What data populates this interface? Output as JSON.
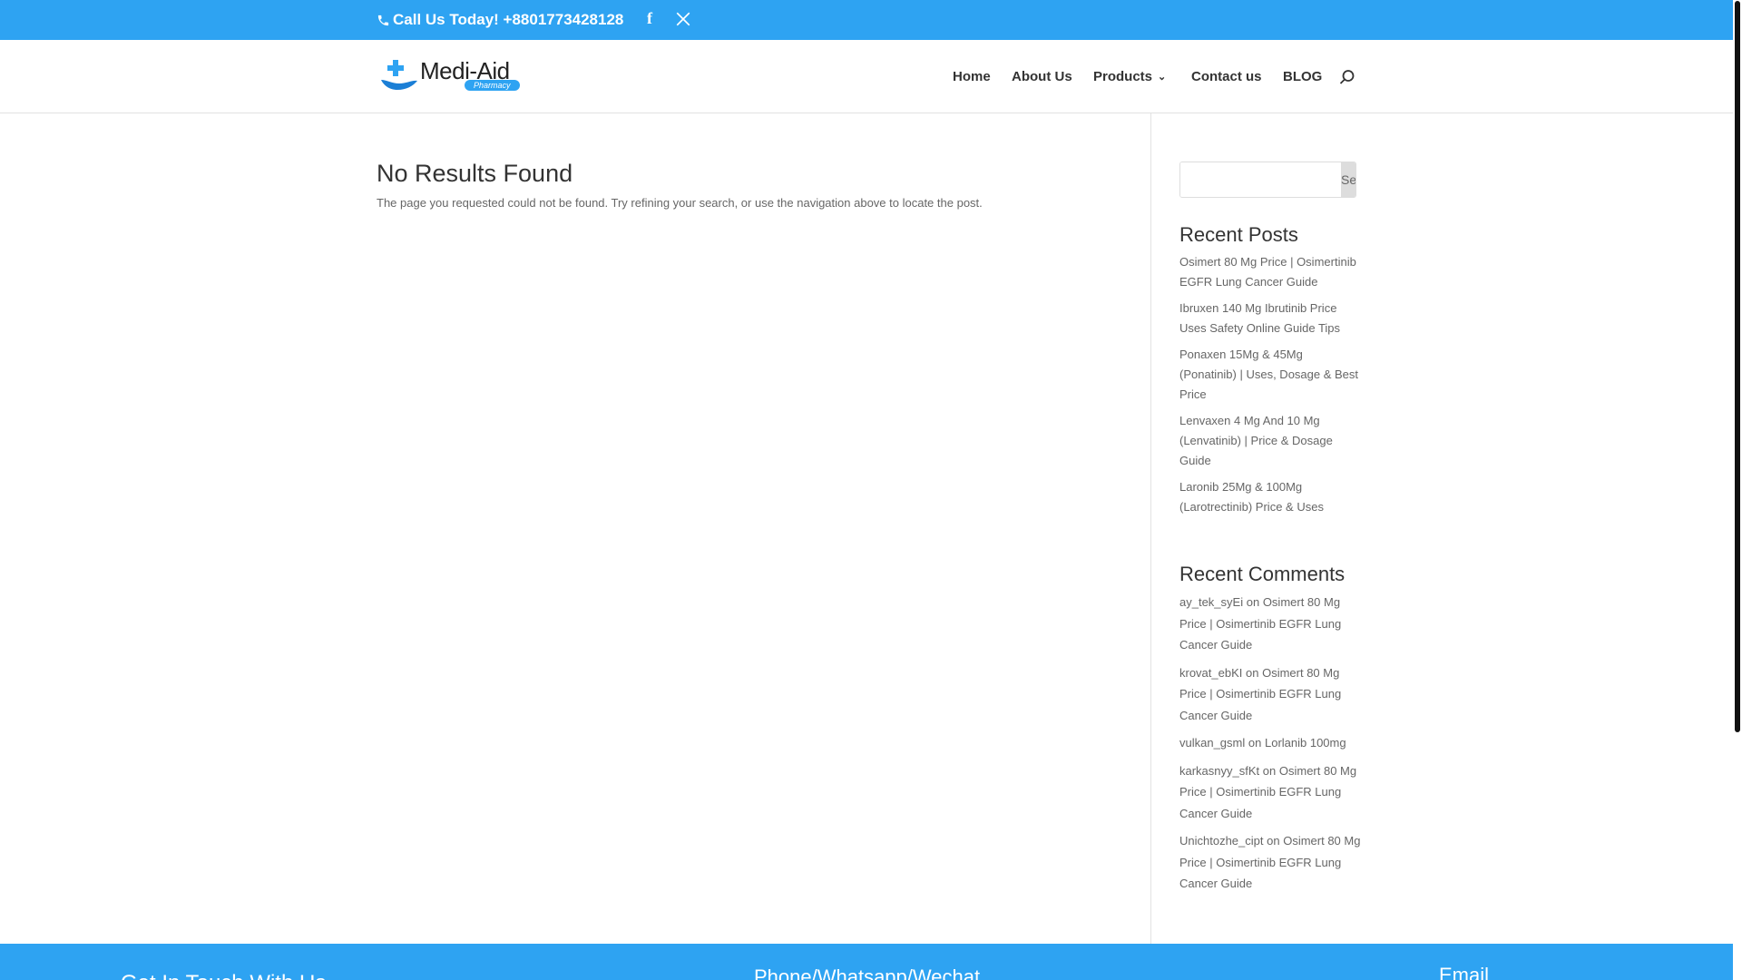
{
  "topbar": {
    "call": "Call Us Today! +8801773428128",
    "facebook_icon": "facebook-icon",
    "x_icon": "x-twitter-icon"
  },
  "header": {
    "logo_text": "Medi-Aid",
    "logo_sub": "Pharmacy",
    "nav": [
      "Home",
      "About Us",
      "Products",
      "Contact us",
      "BLOG"
    ]
  },
  "main": {
    "title": "No Results Found",
    "message": "The page you requested could not be found. Try refining your search, or use the navigation above to locate the post."
  },
  "sidebar": {
    "search_button": "Search",
    "search_value": "",
    "recent_posts_title": "Recent Posts",
    "recent_posts": [
      "Osimert 80 Mg Price | Osimertinib EGFR Lung Cancer Guide",
      "Ibruxen 140 Mg Ibrutinib Price Uses Safety Online Guide Tips",
      "Ponaxen 15Mg & 45Mg (Ponatinib) | Uses, Dosage & Best Price",
      "Lenvaxen 4 Mg And 10 Mg (Lenvatinib) | Price & Dosage Guide",
      "Laronib 25Mg & 100Mg (Larotrectinib) Price & Uses"
    ],
    "recent_comments_title": "Recent Comments",
    "on": "on",
    "recent_comments": [
      {
        "author": "ay_tek_syEi",
        "post": "Osimert 80 Mg Price | Osimertinib EGFR Lung Cancer Guide"
      },
      {
        "author": "krovat_ebKI",
        "post": "Osimert 80 Mg Price | Osimertinib EGFR Lung Cancer Guide"
      },
      {
        "author": "vulkan_gsml",
        "post": "Lorlanib 100mg"
      },
      {
        "author": "karkasnyy_sfKt",
        "post": "Osimert 80 Mg Price | Osimertinib EGFR Lung Cancer Guide"
      },
      {
        "author": "Unichtozhe_cipt",
        "post": "Osimert 80 Mg Price | Osimertinib EGFR Lung Cancer Guide"
      }
    ]
  },
  "footer": {
    "col1": "Get In Touch With Us",
    "col2": "Phone/Whatsapp/Wechat",
    "col3": "Email"
  },
  "colors": {
    "accent": "#2ea3f2"
  }
}
